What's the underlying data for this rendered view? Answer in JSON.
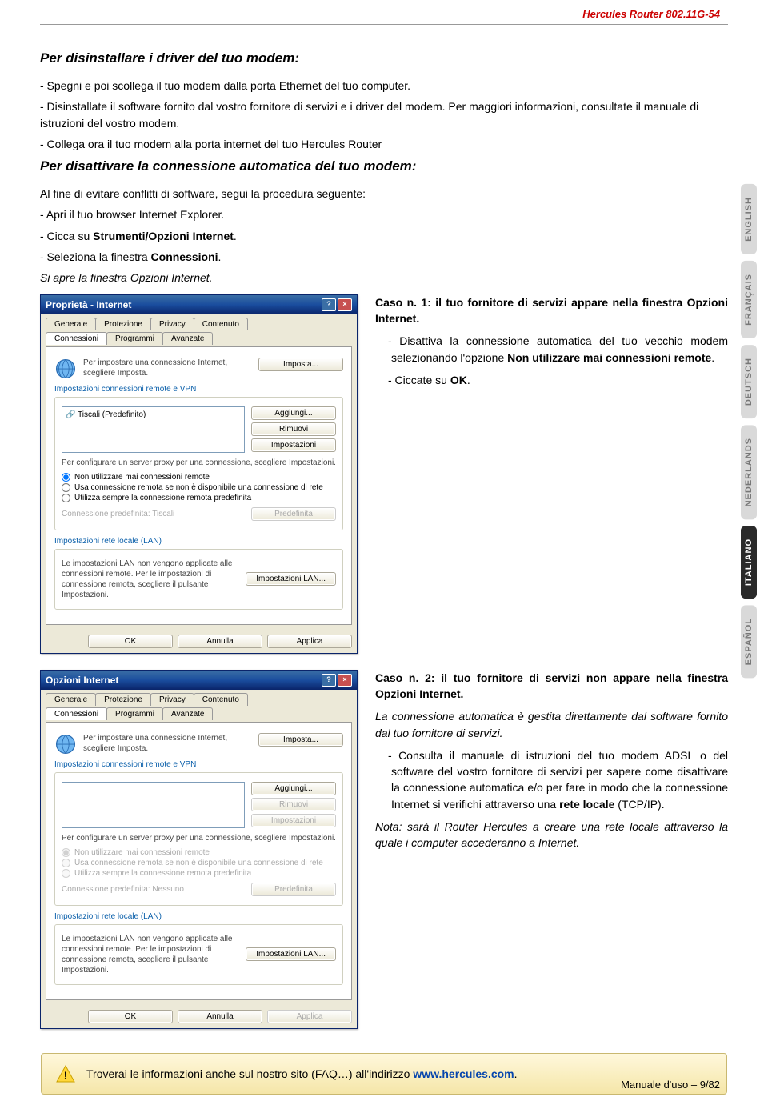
{
  "header": {
    "product": "Hercules Router 802.11G-54"
  },
  "sections": {
    "h1a": "Per disinstallare i driver del tuo modem:",
    "p1": "- Spegni e poi scollega il tuo modem dalla porta Ethernet del tuo computer.",
    "p2": "- Disinstallate il software fornito dal vostro fornitore di servizi e i driver del modem. Per maggiori informazioni, consultate il manuale di istruzioni del vostro modem.",
    "p3": "- Collega ora il tuo modem alla porta internet del tuo Hercules Router",
    "h1b": "Per disattivare la connessione automatica del tuo modem:",
    "p4": "Al fine di evitare conflitti di software, segui la procedura seguente:",
    "p5": "- Apri il tuo browser Internet Explorer.",
    "p6_pre": "- Cicca su ",
    "p6_strong": "Strumenti/Opzioni Internet",
    "p6_post": ".",
    "p7_pre": "- Seleziona la finestra ",
    "p7_strong": "Connessioni",
    "p7_post": ".",
    "p8": "Si apre la finestra Opzioni Internet."
  },
  "case1": {
    "title": "Caso n. 1: il tuo fornitore di servizi appare nella finestra Opzioni Internet.",
    "p1_pre": "- Disattiva la connessione automatica del tuo vecchio modem selezionando l'opzione ",
    "p1_strong": "Non utilizzare mai connessioni remote",
    "p1_post": ".",
    "p2_pre": "- Ciccate su ",
    "p2_strong": "OK",
    "p2_post": "."
  },
  "case2": {
    "title": "Caso n. 2: il tuo fornitore di servizi non appare nella finestra Opzioni Internet.",
    "p1": "La connessione automatica è gestita direttamente dal software fornito dal tuo fornitore di servizi.",
    "p2_pre": "- Consulta il manuale di istruzioni del tuo modem ADSL o del software del vostro fornitore di servizi per sapere come disattivare la connessione automatica e/o per fare in modo che la connessione Internet si verifichi attraverso una ",
    "p2_strong": "rete locale",
    "p2_post": " (TCP/IP).",
    "p3": "Nota: sarà il Router Hercules a creare una rete locale attraverso la quale i computer accederanno a Internet."
  },
  "info": {
    "text_pre": "Troverai le informazioni anche sul nostro sito (FAQ…) all'indirizzo ",
    "link": "www.hercules.com",
    "text_post": "."
  },
  "footer": {
    "text": "Manuale d'uso – 9/82"
  },
  "languages": [
    "ENGLISH",
    "FRANÇAIS",
    "DEUTSCH",
    "NEDERLANDS",
    "ITALIANO",
    "ESPAÑOL"
  ],
  "dialog": {
    "title1": "Proprietà - Internet",
    "title2": "Opzioni Internet",
    "tabs": [
      "Generale",
      "Protezione",
      "Privacy",
      "Contenuto",
      "Connessioni",
      "Programmi",
      "Avanzate"
    ],
    "setupText": "Per impostare una connessione Internet, scegliere Imposta.",
    "btnImposta": "Imposta...",
    "sectionRemote": "Impostazioni connessioni remote e VPN",
    "listItem": "Tiscali (Predefinito)",
    "btnAggiungi": "Aggiungi...",
    "btnRimuovi": "Rimuovi",
    "btnImpostazioni": "Impostazioni",
    "proxyText": "Per configurare un server proxy per una connessione, scegliere Impostazioni.",
    "radio1": "Non utilizzare mai connessioni remote",
    "radio2": "Usa connessione remota se non è disponibile una connessione di rete",
    "radio3": "Utilizza sempre la connessione remota predefinita",
    "predef": "Connessione predefinita:",
    "predefVal1": "Tiscali",
    "predefVal2": "Nessuno",
    "btnPredef": "Predefinita",
    "sectionLan": "Impostazioni rete locale (LAN)",
    "lanText": "Le impostazioni LAN non vengono applicate alle connessioni remote. Per le impostazioni di connessione remota, scegliere il pulsante Impostazioni.",
    "btnLan": "Impostazioni LAN...",
    "btnOk": "OK",
    "btnAnnulla": "Annulla",
    "btnApplica": "Applica"
  }
}
